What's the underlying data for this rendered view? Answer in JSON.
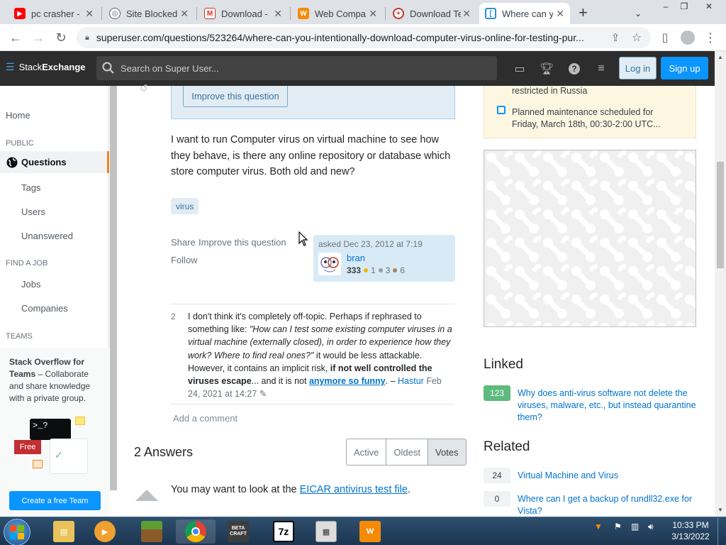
{
  "browser": {
    "tabs": [
      {
        "title": "pc crasher - ",
        "favicon": "youtube-icon",
        "color": "#ff0000"
      },
      {
        "title": "Site Blocked",
        "favicon": "globe-icon",
        "color": "#5f6368"
      },
      {
        "title": "Download - ",
        "favicon": "gmail-icon",
        "color": "#d93025"
      },
      {
        "title": "Web Compar",
        "favicon": "avast-icon",
        "color": "#f58a07"
      },
      {
        "title": "Download Te",
        "favicon": "eicar-icon",
        "color": "#c0392b"
      },
      {
        "title": "Where can y",
        "favicon": "superuser-icon",
        "color": "#2e8fd6"
      }
    ],
    "url": "superuser.com/questions/523264/where-can-you-intentionally-download-computer-virus-online-for-testing-pur..."
  },
  "topbar": {
    "logo_prefix": "Stack",
    "logo_suffix": "Exchange",
    "search_placeholder": "Search on Super User...",
    "login": "Log in",
    "signup": "Sign up"
  },
  "leftnav": {
    "home": "Home",
    "public_heading": "PUBLIC",
    "questions": "Questions",
    "tags": "Tags",
    "users": "Users",
    "unanswered": "Unanswered",
    "job_heading": "FIND A JOB",
    "jobs": "Jobs",
    "companies": "Companies",
    "teams_heading": "TEAMS",
    "teams_title": "Stack Overflow for Teams",
    "teams_desc": " – Collaborate and share knowledge with a private group.",
    "free_badge": "Free",
    "terminal_text": ">_?",
    "create_team": "Create a free Team"
  },
  "question": {
    "improve_button": "Improve this question",
    "body": "I want to run Computer virus on virtual machine to see how they behave, is there any online repository or database which store computer virus. Both old and new?",
    "tag": "virus",
    "share": "Share",
    "improve": "Improve this question",
    "follow": "Follow",
    "asked": "asked Dec 23, 2012 at 7:19",
    "user": "bran",
    "rep": "333",
    "gold": "1",
    "silver": "3",
    "bronze": "6"
  },
  "comment": {
    "score": "2",
    "text_1": "I don't think it's completely off-topic. Perhaps if rephrased to something like: ",
    "quote": "\"How can I test some existing computer viruses in a virtual machine (externally closed), in order to experience how they work? Where to find real ones?\"",
    "text_2": " it would be less attackable. However, it contains an implicit risk, ",
    "bold": "if not well controlled the viruses escape",
    "text_3": "... and it is not ",
    "link": "anymore so funny",
    "text_4": ". – ",
    "author": "Hastur",
    "date": "Feb 24, 2021 at 14:27",
    "add": "Add a comment"
  },
  "answers": {
    "heading": "2 Answers",
    "sort": [
      "Active",
      "Oldest",
      "Votes"
    ],
    "first_text": "You may want to look at the ",
    "first_link": "EICAR antivirus test file",
    "first_end": "."
  },
  "rightbar": {
    "notice_1": "restricted in Russia",
    "notice_2": "Planned maintenance scheduled for Friday, March 18th, 00:30-2:00 UTC...",
    "linked_heading": "Linked",
    "linked": [
      {
        "score": "123",
        "title": "Why does anti-virus software not delete the viruses, malware, etc., but instead quarantine them?"
      }
    ],
    "related_heading": "Related",
    "related": [
      {
        "score": "24",
        "title": "Virtual Machine and Virus"
      },
      {
        "score": "0",
        "title": "Where can I get a backup of rundll32.exe for Vista?"
      }
    ]
  },
  "taskbar": {
    "time": "10:33 PM",
    "date": "3/13/2022",
    "apps": [
      "explorer-icon",
      "media-player-icon",
      "minecraft-icon",
      "chrome-icon",
      "beta-craft-icon",
      "7zip-icon",
      "calculator-icon",
      "avast-icon"
    ],
    "label_7z": "7z",
    "label_beta": "BETA CRAFT"
  }
}
